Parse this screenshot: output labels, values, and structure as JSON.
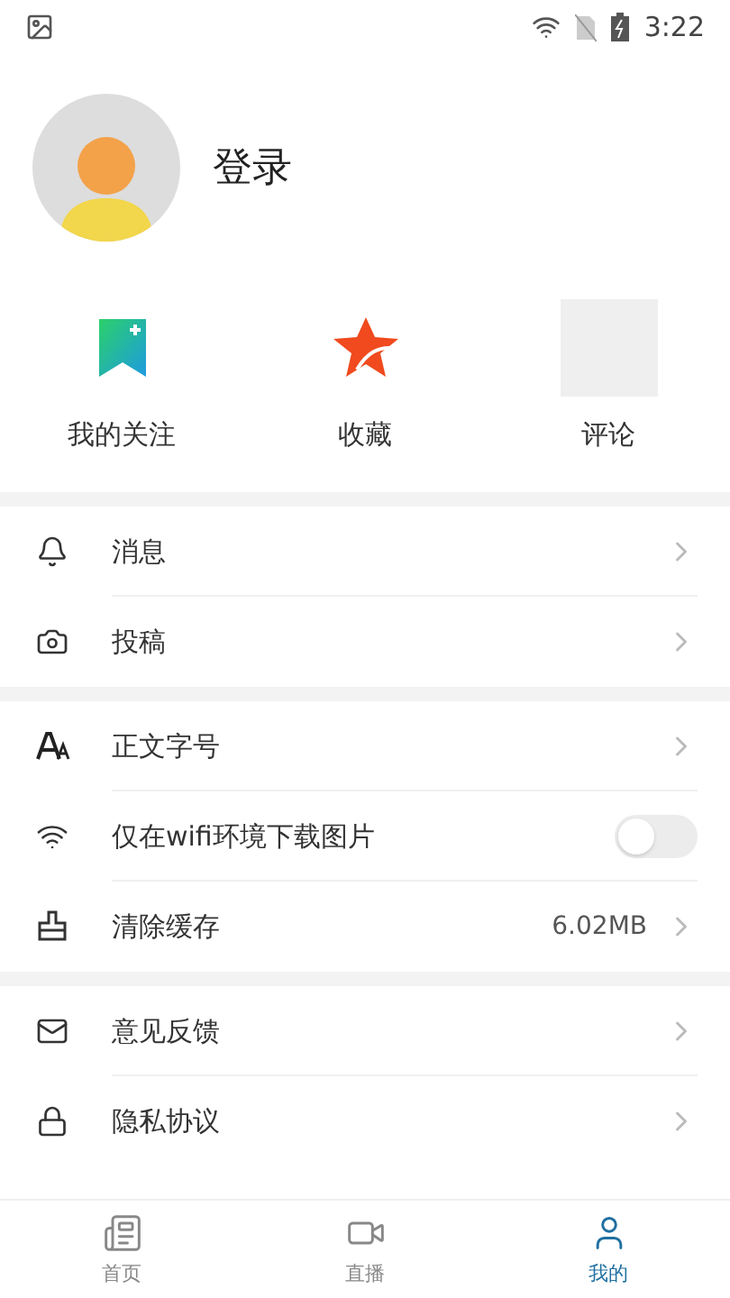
{
  "status_bar": {
    "time": "3:22"
  },
  "profile": {
    "login_label": "登录"
  },
  "shortcuts": [
    {
      "kind": "bookmark",
      "label": "我的关注"
    },
    {
      "kind": "star",
      "label": "收藏"
    },
    {
      "kind": "blank",
      "label": "评论"
    }
  ],
  "menu_groups": [
    [
      {
        "kind": "link",
        "label": "消息"
      },
      {
        "kind": "link",
        "label": "投稿"
      }
    ],
    [
      {
        "kind": "link",
        "label": "正文字号"
      },
      {
        "kind": "toggle",
        "label": "仅在wifi环境下载图片",
        "on": false
      },
      {
        "kind": "value",
        "label": "清除缓存",
        "value": "6.02MB"
      }
    ],
    [
      {
        "kind": "link",
        "label": "意见反馈"
      },
      {
        "kind": "link",
        "label": "隐私协议"
      }
    ]
  ],
  "tab_bar": [
    {
      "label": "首页",
      "selected": false
    },
    {
      "label": "直播",
      "selected": false
    },
    {
      "label": "我的",
      "selected": true
    }
  ]
}
